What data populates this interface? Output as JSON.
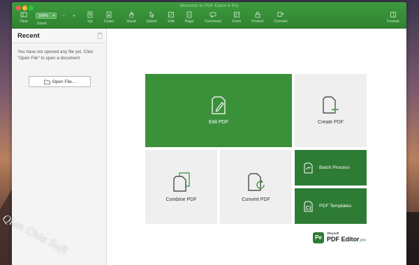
{
  "window": {
    "title": "Welcome to PDF Editor 6 Pro"
  },
  "toolbar": {
    "view_label": "View",
    "zoom_value": "100%",
    "zoom_label": "Zoom",
    "zoom_out": "−",
    "zoom_in": "+",
    "tools": [
      {
        "label": "Up",
        "icon": "up-arrow-icon"
      },
      {
        "label": "Down",
        "icon": "down-arrow-icon"
      },
      {
        "label": "Hand",
        "icon": "hand-icon"
      },
      {
        "label": "Select",
        "icon": "select-cursor-icon"
      },
      {
        "label": "Edit",
        "icon": "edit-icon"
      },
      {
        "label": "Page",
        "icon": "page-icon"
      },
      {
        "label": "Comment",
        "icon": "comment-icon"
      },
      {
        "label": "Form",
        "icon": "form-icon"
      },
      {
        "label": "Protect",
        "icon": "lock-icon"
      },
      {
        "label": "Convert",
        "icon": "convert-icon"
      }
    ],
    "format_label": "Format"
  },
  "sidebar": {
    "title": "Recent",
    "empty_message": "You have not opened any file yet. Click \"Open File\" to open a document.",
    "open_button": "Open File..."
  },
  "tiles": {
    "edit": "Edit PDF",
    "create": "Create PDF",
    "combine": "Combine PDF",
    "convert": "Convert PDF",
    "batch": "Batch Process",
    "templates": "PDF Templates"
  },
  "brand": {
    "logo_text": "Pe",
    "company": "iSkysoft",
    "product": "PDF Editor",
    "edition": "pro"
  },
  "watermark": "Qian Chia Soft",
  "colors": {
    "accent_green": "#3a913a",
    "dark_green": "#2e7b35",
    "tile_gray": "#efefef"
  }
}
